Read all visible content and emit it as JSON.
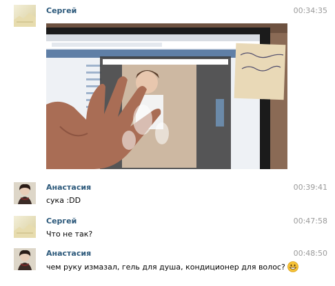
{
  "messages": [
    {
      "author": "Сергей",
      "time": "00:34:35",
      "text": "",
      "avatar": "sergey-avatar"
    },
    {
      "author": "Анастасия",
      "time": "00:39:41",
      "text": "сука :DD",
      "avatar": "anastasia-avatar"
    },
    {
      "author": "Сергей",
      "time": "00:47:58",
      "text": "Что не так?",
      "avatar": "sergey-avatar"
    },
    {
      "author": "Анастасия",
      "time": "00:48:50",
      "text": "чем руку измазал, гель для душа, кондиционер для волос?",
      "avatar": "anastasia-avatar",
      "emoji": "grinning-emoji"
    }
  ],
  "photo": {
    "sticky_note_lines": [
      "Я конечно",
      "Спасибо"
    ]
  }
}
